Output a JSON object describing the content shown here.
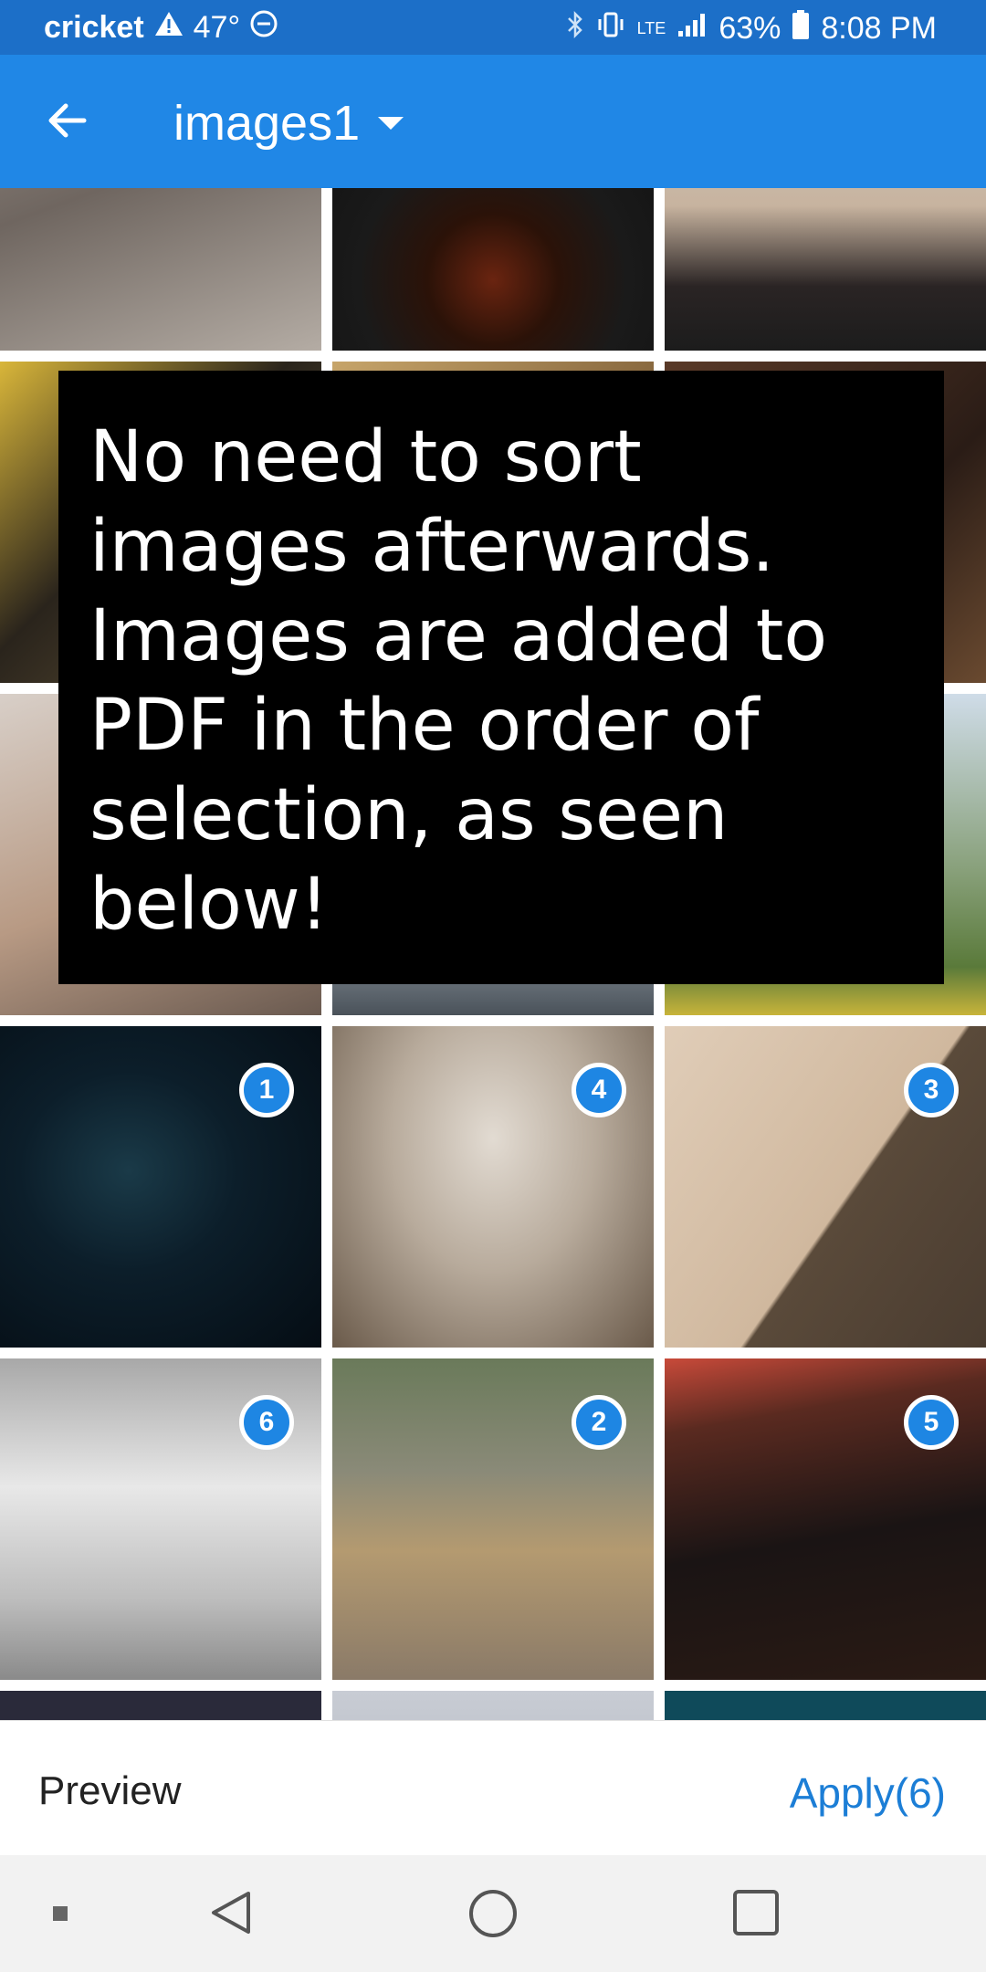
{
  "status_bar": {
    "carrier": "cricket",
    "temperature": "47°",
    "network": "LTE",
    "battery": "63%",
    "time": "8:08 PM"
  },
  "app_bar": {
    "album_title": "images1"
  },
  "tooltip": {
    "text": "No need to sort images afterwards. Images are added to PDF in the order of selection, as seen below!"
  },
  "selection_badges": [
    "1",
    "4",
    "3",
    "6",
    "2",
    "5"
  ],
  "bottom_bar": {
    "preview_label": "Preview",
    "apply_label": "Apply(6)"
  },
  "colors": {
    "app_bar": "#2087e6",
    "status_bar": "#1c6fc8",
    "badge": "#1e86e3",
    "apply_text": "#1c7ed6"
  }
}
